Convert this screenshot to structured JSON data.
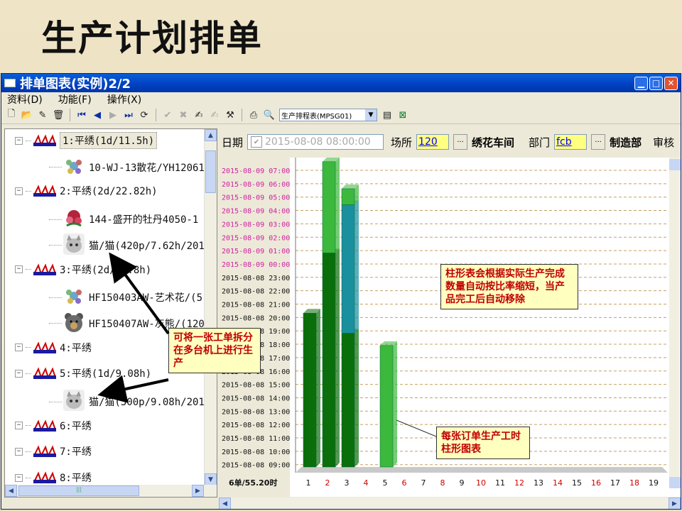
{
  "slide": {
    "title": "生产计划排单"
  },
  "window": {
    "title": "排单图表(实例)2/2",
    "menus": [
      "资料(D)",
      "功能(F)",
      "操作(X)"
    ],
    "toolbar_select": "生产排程表(MPSG01)"
  },
  "tree": [
    {
      "machine": "1:平绣(1d/11.5h)",
      "children": [
        {
          "label": "10-WJ-13散花/YH12061",
          "icon": "flower-icon"
        }
      ]
    },
    {
      "machine": "2:平绣(2d/22.82h)",
      "children": [
        {
          "label": "144-盛开的牡丹4050-1",
          "icon": "peony-icon"
        },
        {
          "label": "猫/猫(420p/7.62h/201",
          "icon": "cat-icon"
        }
      ]
    },
    {
      "machine": "3:平绣(2d/14.8h)",
      "children": [
        {
          "label": "HF150403AW-艺术花/(5",
          "icon": "flower-icon"
        },
        {
          "label": "HF150407AW-灰熊/(120",
          "icon": "bear-icon"
        }
      ]
    },
    {
      "machine": "4:平绣",
      "children": []
    },
    {
      "machine": "5:平绣(1d/9.08h)",
      "children": [
        {
          "label": "猫/猫(500p/9.08h/201",
          "icon": "cat-icon"
        }
      ]
    },
    {
      "machine": "6:平绣",
      "children": []
    },
    {
      "machine": "7:平绣",
      "children": []
    },
    {
      "machine": "8:平绣",
      "children": []
    }
  ],
  "filter": {
    "date_label": "日期",
    "date_value": "2015-08-08 08:00:00",
    "site_label": "场所",
    "site_value": "120",
    "site_name": "绣花车间",
    "dept_label": "部门",
    "dept_value": "fcb",
    "dept_name": "制造部",
    "review_label": "审核"
  },
  "chart_data": {
    "type": "bar",
    "y_categories": [
      "2015-08-09 07:00",
      "2015-08-09 06:00",
      "2015-08-09 05:00",
      "2015-08-09 04:00",
      "2015-08-09 03:00",
      "2015-08-09 02:00",
      "2015-08-09 01:00",
      "2015-08-09 00:00",
      "2015-08-08 23:00",
      "2015-08-08 22:00",
      "2015-08-08 21:00",
      "2015-08-08 20:00",
      "2015-08-08 19:00",
      "2015-08-08 18:00",
      "2015-08-08 17:00",
      "2015-08-08 16:00",
      "2015-08-08 15:00",
      "2015-08-08 14:00",
      "2015-08-08 13:00",
      "2015-08-08 12:00",
      "2015-08-08 11:00",
      "2015-08-08 10:00",
      "2015-08-08 09:00"
    ],
    "categories": [
      "1",
      "2",
      "3",
      "4",
      "5",
      "6",
      "7",
      "8",
      "9",
      "10",
      "11",
      "12",
      "13",
      "14",
      "15",
      "16",
      "17",
      "18",
      "19"
    ],
    "series": [
      {
        "values": [
          11.5,
          16.0,
          10.0,
          0,
          0,
          0,
          0,
          0,
          0,
          0,
          0,
          0,
          0,
          0,
          0,
          0,
          0,
          0,
          0
        ],
        "color": "#0a6e0a"
      },
      {
        "values": [
          0,
          6.82,
          0,
          0,
          9.08,
          0,
          0,
          0,
          0,
          0,
          0,
          0,
          0,
          0,
          0,
          0,
          0,
          0,
          0
        ],
        "color": "#3cb83c"
      },
      {
        "values": [
          0,
          0,
          9.6,
          0,
          0,
          0,
          0,
          0,
          0,
          0,
          0,
          0,
          0,
          0,
          0,
          0,
          0,
          0,
          0
        ],
        "color": "#1a8f9e"
      },
      {
        "values": [
          0,
          0,
          1.2,
          0,
          0,
          0,
          0,
          0,
          0,
          0,
          0,
          0,
          0,
          0,
          0,
          0,
          0,
          0,
          0
        ],
        "color": "#3cb83c"
      }
    ],
    "summary": "6单/55.20时",
    "grid": true,
    "ylim_hours": [
      0,
      24
    ]
  },
  "callouts": {
    "split": "可将一张工单拆分在多台机上进行生产",
    "shrink": "柱形表会根据实际生产完成数量自动按比率缩短，当产品完工后自动移除",
    "bars": "每张订单生产工时柱形图表"
  }
}
